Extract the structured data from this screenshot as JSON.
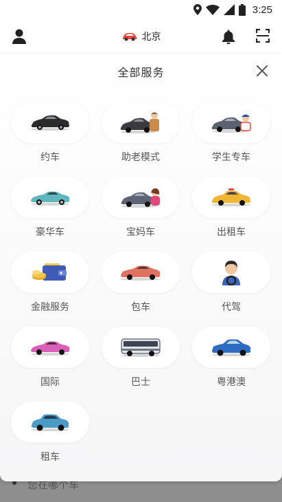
{
  "status_bar": {
    "time": "3:25",
    "icons": [
      "location-icon",
      "wifi-icon",
      "signal-icon",
      "battery-icon"
    ]
  },
  "header": {
    "city": "北京",
    "icons": [
      "user-icon",
      "car-logo-icon",
      "bell-icon",
      "scan-icon"
    ]
  },
  "sheet": {
    "title": "全部服务",
    "close_icon": "close-icon"
  },
  "services": [
    {
      "label": "约车",
      "icon": "black-sedan-icon",
      "color": "#2b2b2e"
    },
    {
      "label": "助老模式",
      "icon": "sedan-elderly-icon",
      "color": "#3a3a3f"
    },
    {
      "label": "学生专车",
      "icon": "sedan-student-icon",
      "color": "#5a6170"
    },
    {
      "label": "豪华车",
      "icon": "teal-luxury-car-icon",
      "color": "#5fb6bd"
    },
    {
      "label": "宝妈车",
      "icon": "sedan-mother-icon",
      "color": "#5c6475"
    },
    {
      "label": "出租车",
      "icon": "yellow-taxi-icon",
      "color": "#f2b534"
    },
    {
      "label": "金融服务",
      "icon": "wallet-coins-icon",
      "color": "#3f5bb5"
    },
    {
      "label": "包车",
      "icon": "coral-car-icon",
      "color": "#e0705f"
    },
    {
      "label": "代驾",
      "icon": "driver-icon",
      "color": "#3b63b8"
    },
    {
      "label": "国际",
      "icon": "pink-car-icon",
      "color": "#d95fb8"
    },
    {
      "label": "巴士",
      "icon": "bus-icon",
      "color": "#6e7585"
    },
    {
      "label": "粤港澳",
      "icon": "blue-suv-icon",
      "color": "#2e6cc4"
    },
    {
      "label": "租车",
      "icon": "blue-hatchback-icon",
      "color": "#4b9bc9"
    }
  ],
  "background_text": "您在哪个车"
}
